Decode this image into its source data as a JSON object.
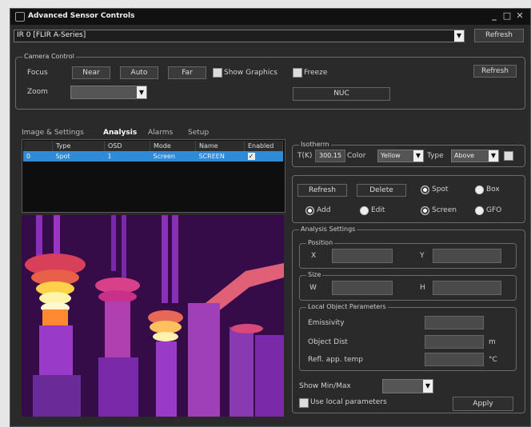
{
  "window": {
    "title": "Advanced Sensor Controls"
  },
  "camera_select": {
    "value": "IR 0 [FLIR A-Series]",
    "refresh_label": "Refresh"
  },
  "camera_control": {
    "title": "Camera Control",
    "focus_label": "Focus",
    "near_label": "Near",
    "auto_label": "Auto",
    "far_label": "Far",
    "show_graphics_label": "Show Graphics",
    "freeze_label": "Freeze",
    "refresh_label": "Refresh",
    "zoom_label": "Zoom",
    "nuc_label": "NUC"
  },
  "tabs": [
    {
      "label": "Image & Settings"
    },
    {
      "label": "Analysis"
    },
    {
      "label": "Alarms"
    },
    {
      "label": "Setup"
    }
  ],
  "table": {
    "headers": [
      "",
      "Type",
      "OSD",
      "Mode",
      "Name",
      "Enabled"
    ],
    "rows": [
      {
        "index": "0",
        "type": "Spot",
        "osd": "1",
        "mode": "Screen",
        "name": "SCREEN"
      }
    ]
  },
  "isotherm": {
    "title": "Isotherm",
    "temp_label": "T(K)",
    "temp_value": "300.15",
    "color_label": "Color",
    "color_value": "Yellow",
    "type_label": "Type",
    "type_value": "Above"
  },
  "analysis_tools": {
    "refresh_label": "Refresh",
    "delete_label": "Delete",
    "spot_label": "Spot",
    "box_label": "Box",
    "add_label": "Add",
    "edit_label": "Edit",
    "screen_label": "Screen",
    "gfo_label": "GFO"
  },
  "analysis_settings": {
    "title": "Analysis Settings",
    "position_title": "Position",
    "x_label": "X",
    "y_label": "Y",
    "size_title": "Size",
    "w_label": "W",
    "h_label": "H",
    "local_title": "Local Object Parameters",
    "emissivity_label": "Emissivity",
    "object_dist_label": "Object Dist",
    "object_dist_unit": "m",
    "refl_temp_label": "Refl. app. temp",
    "refl_temp_unit": "°C",
    "show_minmax_label": "Show Min/Max",
    "use_local_label": "Use local parameters",
    "apply_label": "Apply"
  }
}
